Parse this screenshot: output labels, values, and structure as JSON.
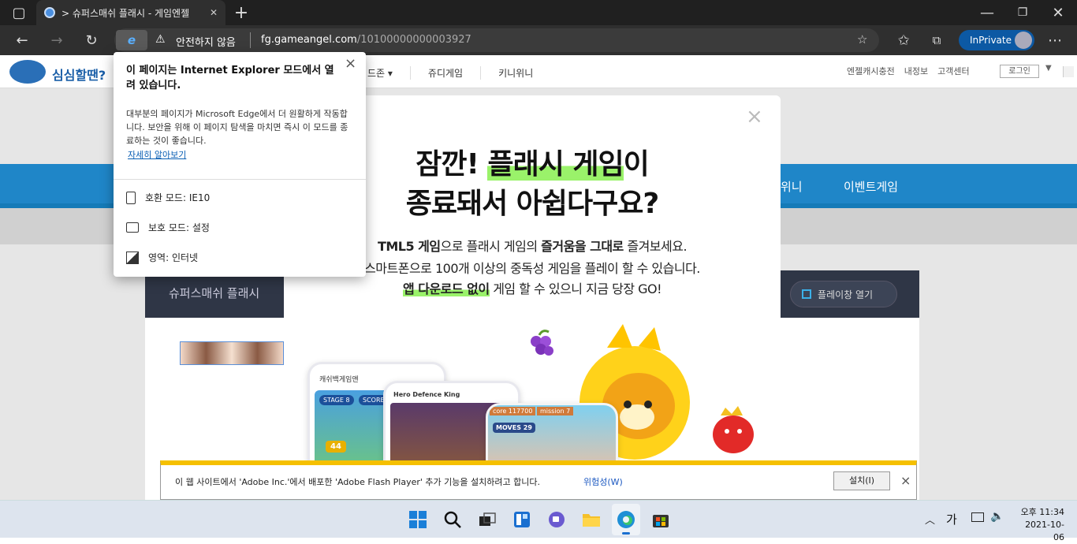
{
  "browser": {
    "tab_title": "> 슈퍼스매쉬 플래시 - 게임엔젤",
    "security_label": "안전하지 않음",
    "url_host": "fg.gameangel.com",
    "url_path": "/10100000000003927",
    "inprivate_label": "InPrivate"
  },
  "site": {
    "logo_text": "심심할땐?",
    "nav": [
      "드존 ▾",
      "쥬디게임",
      "키니위니"
    ],
    "top_links": [
      "엔젤캐시충전",
      "내정보",
      "고객센터"
    ],
    "login_label": "로그인",
    "band_items": [
      "위니",
      "이벤트게임"
    ],
    "game_title": "슈퍼스매쉬 플래시",
    "open_window_label": "플레이창 열기"
  },
  "modal": {
    "close": "×",
    "headline1_pre": "잠깐! ",
    "headline1_hl": "플래시 게임",
    "headline1_post": "이",
    "headline2": "종료돼서 아쉽다구요?",
    "line1_bold": "TML5 게임",
    "line1_mid": "으로 플래시 게임의 ",
    "line1_bold2": "즐거움을 그대로",
    "line1_post": " 즐겨보세요.",
    "line2": "스마트폰으로 100개 이상의 중독성 게임을 플레이 할 수 있습니다.",
    "line3_hl": "앱 다운로드 없이",
    "line3_post": " 게임 할 수 있으니 지금 당장 GO!",
    "phone1_title": "캐쉬백게임앤",
    "phone1_stage": "STAGE 8",
    "phone1_score": "SCORE 54.5",
    "phone1_badge": "44",
    "phone2_title": "Hero Defence King",
    "phone3_score": "core 117700",
    "phone3_mission": "mission 7",
    "phone3_moves": "MOVES 29"
  },
  "ie_popup": {
    "title": "이 페이지는 Internet Explorer 모드에서 열려 있습니다.",
    "body": "대부분의 페이지가 Microsoft Edge에서 더 원활하게 작동합니다. 보안을 위해 이 페이지 탐색을 마치면 즉시 이 모드를 종료하는 것이 좋습니다.",
    "learn_more": "자세히 알아보기",
    "compat_mode": "호환 모드: IE10",
    "protect_mode": "보호 모드: 설정",
    "zone": "영역: 인터넷",
    "close": "×"
  },
  "infobar": {
    "message": "이 웹 사이트에서 'Adobe Inc.'에서 배포한 'Adobe Flash Player' 추가 기능을 설치하려고 합니다.",
    "risk_link": "위험성(W)",
    "install_label": "설치(I)",
    "close": "×"
  },
  "taskbar": {
    "ime": "가",
    "ampm_time": "오후 11:34",
    "date": "2021-10-06"
  },
  "colors": {
    "accent": "#0c59a4",
    "blue_band": "#1f86c8",
    "highlight": "#9af26a",
    "info_yellow": "#f5c000"
  }
}
